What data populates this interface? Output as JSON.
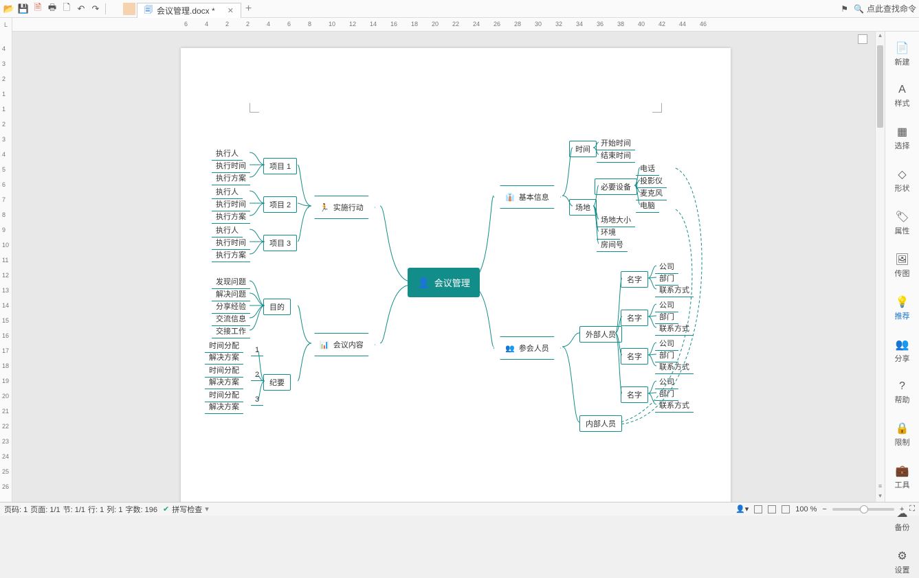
{
  "tab": {
    "title": "会议管理.docx *"
  },
  "search_placeholder": "点此查找命令",
  "ruler_h": [
    6,
    4,
    2,
    2,
    4,
    6,
    8,
    10,
    12,
    14,
    16,
    18,
    20,
    22,
    24,
    26,
    28,
    30,
    32,
    34,
    36,
    38,
    40,
    42,
    44,
    46
  ],
  "ruler_v": [
    4,
    3,
    2,
    1,
    1,
    2,
    3,
    4,
    5,
    6,
    7,
    8,
    9,
    10,
    11,
    12,
    13,
    14,
    15,
    16,
    17,
    18,
    19,
    20,
    21,
    22,
    23,
    24,
    25,
    26
  ],
  "sidepanel": [
    {
      "icon": "📄",
      "label": "新建"
    },
    {
      "icon": "A",
      "label": "样式"
    },
    {
      "icon": "▦",
      "label": "选择"
    },
    {
      "icon": "◇",
      "label": "形状"
    },
    {
      "icon": "🏷",
      "label": "属性"
    },
    {
      "icon": "🖼",
      "label": "传图"
    },
    {
      "icon": "💡",
      "label": "推荐",
      "active": true
    },
    {
      "icon": "👥",
      "label": "分享"
    },
    {
      "icon": "?",
      "label": "帮助"
    },
    {
      "icon": "🔒",
      "label": "限制"
    },
    {
      "icon": "💼",
      "label": "工具"
    },
    {
      "icon": "☁",
      "label": "备份"
    },
    {
      "icon": "⚙",
      "label": "设置"
    }
  ],
  "status": {
    "page": "页码: 1",
    "pageof": "页面: 1/1",
    "sec": "节: 1/1",
    "row": "行: 1",
    "col": "列: 1",
    "words": "字数: 196",
    "spell": "拼写检查",
    "zoom": "100 %"
  },
  "mindmap": {
    "root": "会议管理",
    "left_top": {
      "label": "实施行动",
      "projects": [
        "项目  1",
        "项目  2",
        "项目  3"
      ],
      "sub": [
        "执行人",
        "执行时间",
        "执行方案"
      ]
    },
    "left_bottom": {
      "label": "会议内容",
      "purpose": {
        "label": "目的",
        "items": [
          "发现问题",
          "解决问题",
          "分享经验",
          "交流信息",
          "交接工作"
        ]
      },
      "minutes": {
        "label": "纪要",
        "groups": [
          {
            "n": "1",
            "items": [
              "时间分配",
              "解决方案"
            ]
          },
          {
            "n": "2",
            "items": [
              "时间分配",
              "解决方案"
            ]
          },
          {
            "n": "3",
            "items": [
              "时间分配",
              "解决方案"
            ]
          }
        ]
      }
    },
    "right_top": {
      "label": "基本信息",
      "time": {
        "label": "时间",
        "items": [
          "开始时间",
          "结束时间"
        ]
      },
      "venue": {
        "label": "场地",
        "equip": {
          "label": "必要设备",
          "items": [
            "电话",
            "投影仪",
            "麦克风",
            "电脑"
          ]
        },
        "others": [
          "场地大小",
          "环境",
          "房间号"
        ]
      }
    },
    "right_bottom": {
      "label": "参会人员",
      "external": {
        "label": "外部人员",
        "name": "名字",
        "items": [
          "公司",
          "部门",
          "联系方式"
        ]
      },
      "internal": {
        "label": "内部人员"
      }
    }
  }
}
